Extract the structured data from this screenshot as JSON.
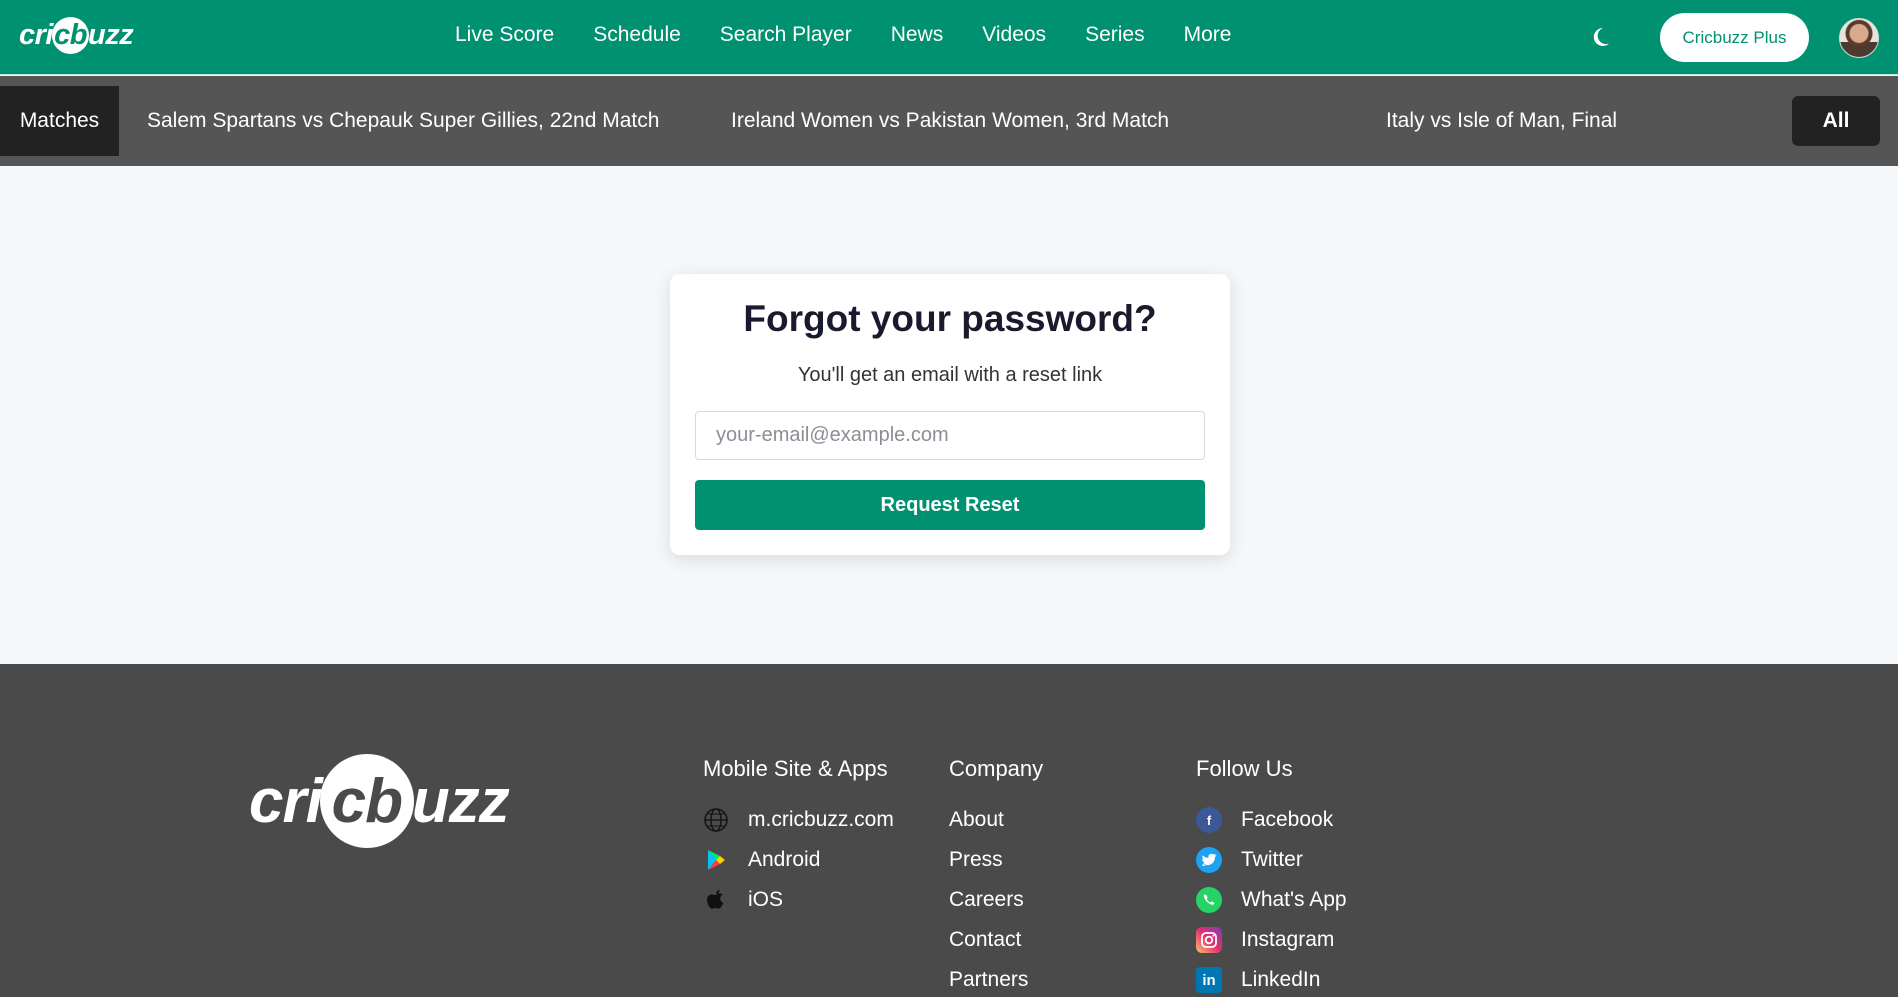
{
  "header": {
    "logo_text_left": "cri",
    "logo_text_ball": "cb",
    "logo_text_right": "uzz",
    "nav": [
      "Live Score",
      "Schedule",
      "Search Player",
      "News",
      "Videos",
      "Series",
      "More"
    ],
    "plus_label": "Cricbuzz Plus",
    "accent": "#009270"
  },
  "strip": {
    "matches_label": "Matches",
    "matches": [
      "Salem Spartans vs Chepauk Super Gillies, 22nd Match",
      "Ireland Women vs Pakistan Women, 3rd Match",
      "Italy vs Isle of Man, Final"
    ],
    "all_label": "All"
  },
  "form": {
    "title": "Forgot your password?",
    "subtitle": "You'll get an email with a reset link",
    "email_placeholder": "your-email@example.com",
    "email_value": "",
    "button_label": "Request Reset"
  },
  "footer": {
    "logo_text_left": "cri",
    "logo_text_ball": "cb",
    "logo_text_right": "uzz",
    "apps": {
      "heading": "Mobile Site & Apps",
      "items": [
        {
          "label": "m.cricbuzz.com",
          "icon": "globe-icon"
        },
        {
          "label": "Android",
          "icon": "play-store-icon"
        },
        {
          "label": "iOS",
          "icon": "apple-icon"
        }
      ]
    },
    "company": {
      "heading": "Company",
      "items": [
        "About",
        "Press",
        "Careers",
        "Contact",
        "Partners"
      ]
    },
    "follow": {
      "heading": "Follow Us",
      "items": [
        {
          "label": "Facebook",
          "icon": "facebook-icon",
          "color": "#3b5998"
        },
        {
          "label": "Twitter",
          "icon": "twitter-icon",
          "color": "#1da1f2"
        },
        {
          "label": "What's App",
          "icon": "whatsapp-icon",
          "color": "#25d366"
        },
        {
          "label": "Instagram",
          "icon": "instagram-icon",
          "color": "#e1306c"
        },
        {
          "label": "LinkedIn",
          "icon": "linkedin-icon",
          "color": "#0077b5"
        }
      ]
    }
  }
}
